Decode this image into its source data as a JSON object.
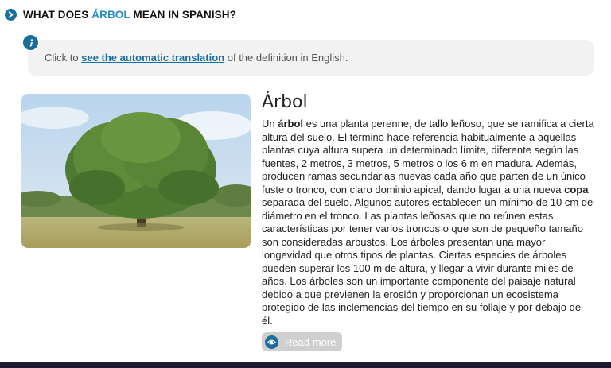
{
  "heading": {
    "prefix": "WHAT DOES ",
    "word": "ÁRBOL",
    "suffix": " MEAN IN SPANISH?"
  },
  "info": {
    "before": "Click to ",
    "link": "see the automatic translation",
    "after": " of the definition in English."
  },
  "definition": {
    "title": "Árbol",
    "p1": "Un ",
    "b1": "árbol",
    "p2": " es una planta perenne, de tallo leñoso, que se ramifica a cierta altura del suelo. El término hace referencia habitualmente a aquellas plantas cuya altura supera un determinado límite, diferente según las fuentes, 2 metros, 3 metros, 5 metros o los 6 m en madura. Además, producen ramas secundarias nuevas cada año que parten de un único fuste o tronco, con claro dominio apical, dando lugar a una nueva ",
    "b2": "copa",
    "p3": " separada del suelo. Algunos autores establecen un mínimo de 10 cm de diámetro en el tronco. Las plantas leñosas que no reúnen estas características por tener varios troncos o que son de pequeño tamaño son consideradas arbustos. Los árboles presentan una mayor longevidad que otros tipos de plantas. Ciertas especies de árboles pueden superar los 100 m de altura, y llegar a vivir durante miles de años. Los árboles son un importante componente del paisaje natural debido a que previenen la erosión y proporcionan un ecosistema protegido de las inclemencias del tiempo en su follaje y por debajo de él."
  },
  "read_more": {
    "label": "Read more",
    "icon": "eye-icon"
  },
  "colors": {
    "accent": "#1a6e9c",
    "highlight": "#2b8cc4",
    "info_bg": "#f2f2f2",
    "button_bg": "#cfcfcf",
    "footer": "#1f1a33"
  }
}
